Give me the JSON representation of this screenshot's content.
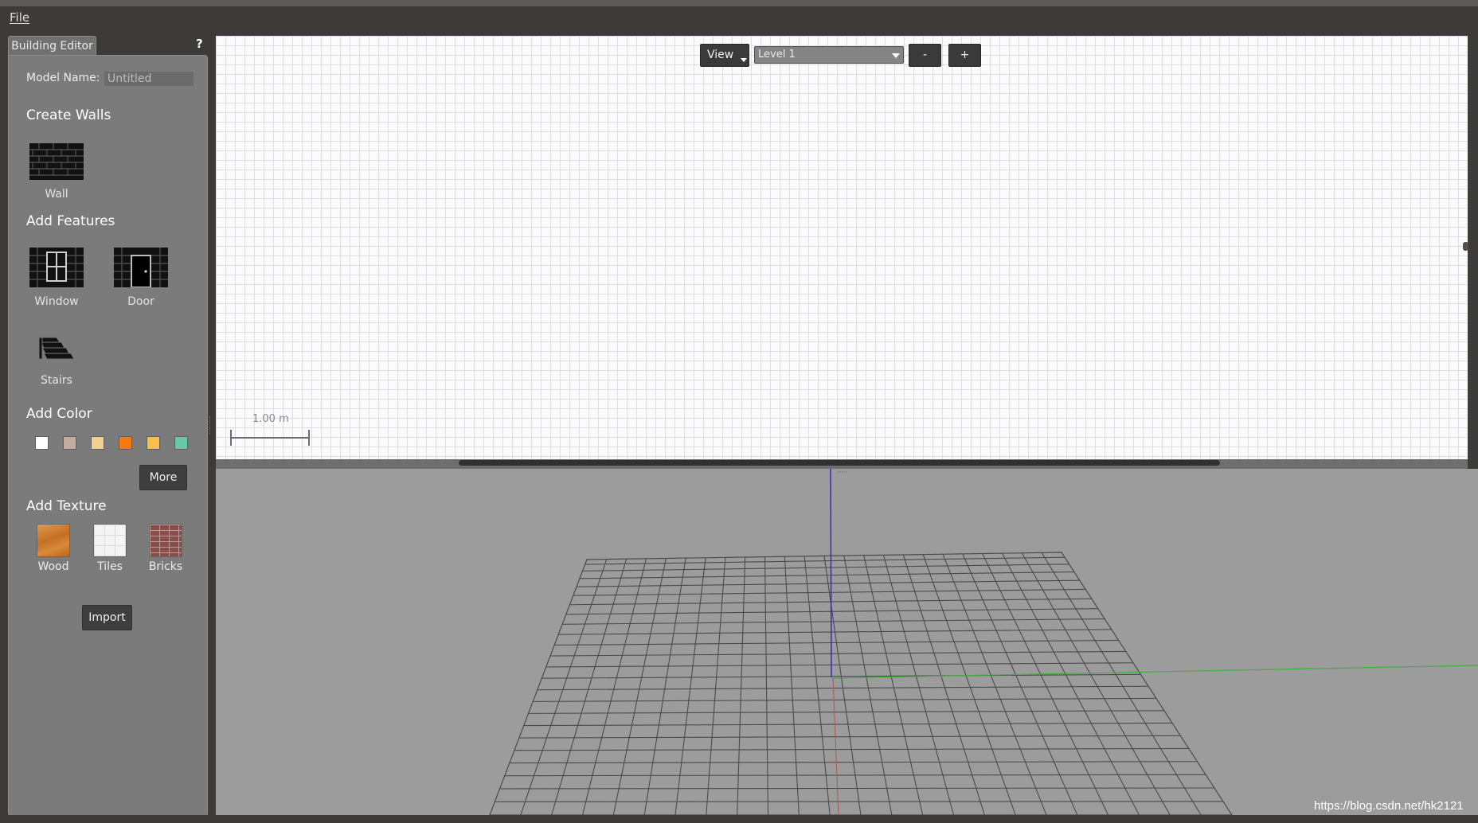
{
  "menu": {
    "file": "File"
  },
  "dock": {
    "tab_title": "Building Editor",
    "help": "?",
    "model_name_label": "Model Name:",
    "model_name_value": "Untitled"
  },
  "sections": {
    "create_walls": "Create Walls",
    "add_features": "Add Features",
    "add_color": "Add Color",
    "add_texture": "Add Texture"
  },
  "tools": {
    "wall": "Wall",
    "window": "Window",
    "door": "Door",
    "stairs": "Stairs"
  },
  "colors": [
    "#ffffff",
    "#c4aba2",
    "#f0d095",
    "#f47a10",
    "#f8c04b",
    "#69c9a7"
  ],
  "buttons": {
    "more": "More",
    "import": "Import"
  },
  "textures": [
    {
      "label": "Wood",
      "color": "#c9762e"
    },
    {
      "label": "Tiles",
      "color": "#efefef"
    },
    {
      "label": "Bricks",
      "color": "#8a4d4a"
    }
  ],
  "editor2d": {
    "view_label": "View",
    "level_value": "Level 1",
    "zoom_out": "-",
    "zoom_in": "+",
    "scale_label": "1.00 m"
  },
  "watermark": "https://blog.csdn.net/hk2121"
}
